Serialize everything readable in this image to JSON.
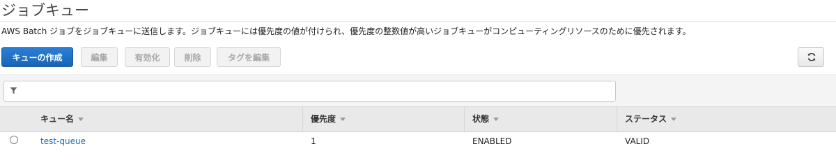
{
  "page": {
    "title": "ジョブキュー",
    "description": "AWS Batch ジョブをジョブキューに送信します。ジョブキューには優先度の値が付けられ、優先度の整数値が高いジョブキューがコンピューティングリソースのために優先されます。"
  },
  "toolbar": {
    "create_label": "キューの作成",
    "edit_label": "編集",
    "enable_label": "有効化",
    "delete_label": "削除",
    "edit_tags_label": "タグを編集",
    "refresh_icon": "refresh-icon"
  },
  "filter": {
    "icon": "filter-icon",
    "value": "",
    "placeholder": ""
  },
  "table": {
    "columns": [
      "キュー名",
      "優先度",
      "状態",
      "ステータス"
    ],
    "rows": [
      {
        "name": "test-queue",
        "priority": "1",
        "state": "ENABLED",
        "status": "VALID",
        "selected": false
      }
    ]
  },
  "colors": {
    "primary": "#1a64b8",
    "link": "#1a6dc0",
    "header_bg": "#e9e9e9",
    "filter_bg": "#f4f4f4"
  }
}
